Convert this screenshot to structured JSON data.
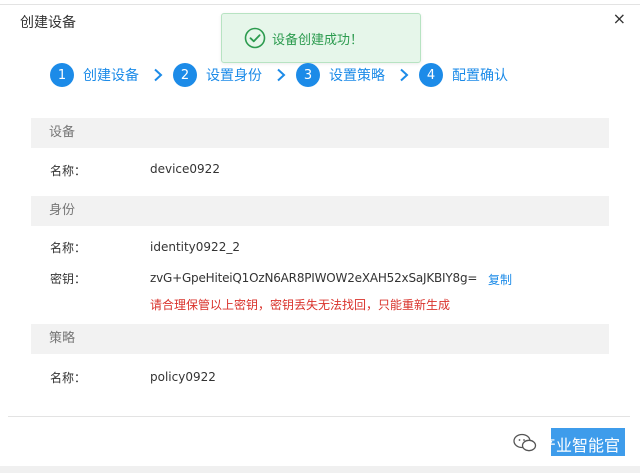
{
  "dialog": {
    "title": "创建设备",
    "close_glyph": "×"
  },
  "toast": {
    "message": "设备创建成功！",
    "icon": "check-circle-icon",
    "color": "#2c9b4f"
  },
  "steps": [
    {
      "num": "1",
      "label": "创建设备"
    },
    {
      "num": "2",
      "label": "设置身份"
    },
    {
      "num": "3",
      "label": "设置策略"
    },
    {
      "num": "4",
      "label": "配置确认"
    }
  ],
  "sections": {
    "device": {
      "header": "设备",
      "name_label": "名称：",
      "name_value": "device0922"
    },
    "identity": {
      "header": "身份",
      "name_label": "名称：",
      "name_value": "identity0922_2",
      "key_label": "密钥：",
      "key_value": "zvG+GpeHiteiQ1OzN6AR8PIWOW2eXAH52xSaJKBIY8g=",
      "copy_label": "复制",
      "warning": "请合理保管以上密钥，密钥丢失无法找回，只能重新生成"
    },
    "policy": {
      "header": "策略",
      "name_label": "名称：",
      "name_value": "policy0922"
    }
  },
  "watermark": {
    "text": "产业智能官",
    "icon": "wechat-bubble-icon"
  },
  "colors": {
    "accent": "#1c8be8",
    "warning": "#d9322b",
    "section_bg": "#f2f2f2"
  }
}
